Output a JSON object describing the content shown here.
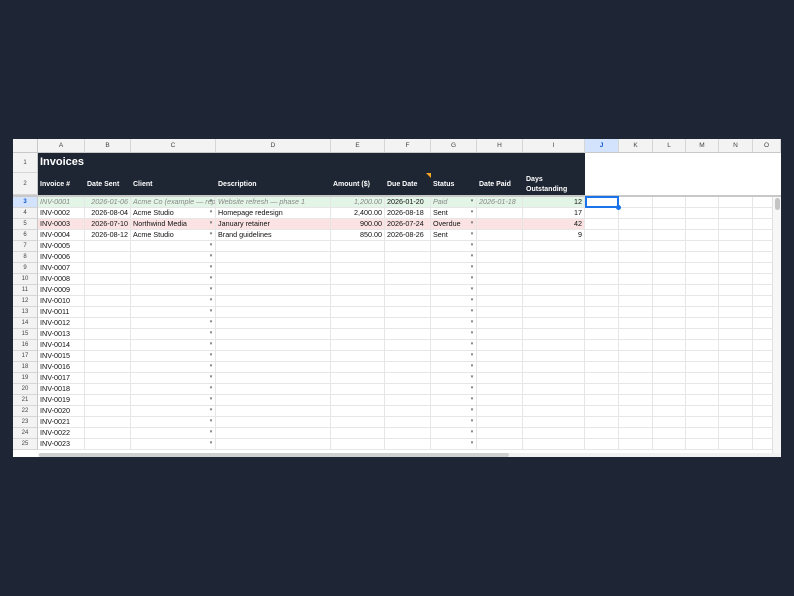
{
  "columns": [
    "A",
    "B",
    "C",
    "D",
    "E",
    "F",
    "G",
    "H",
    "I",
    "J",
    "K",
    "L",
    "M",
    "N",
    "O"
  ],
  "active_column": "J",
  "active_row": 3,
  "title": "Invoices",
  "headers": {
    "invoice": "Invoice #",
    "date_sent": "Date Sent",
    "client": "Client",
    "description": "Description",
    "amount": "Amount ($)",
    "due_date": "Due Date",
    "status": "Status",
    "date_paid": "Date Paid",
    "days_1": "Days",
    "days_2": "Outstanding"
  },
  "row_numbers": [
    "1",
    "2",
    "3",
    "4",
    "5",
    "6",
    "7",
    "8",
    "9",
    "10",
    "11",
    "12",
    "13",
    "14",
    "15",
    "16",
    "17",
    "18",
    "19",
    "20",
    "21",
    "22",
    "23",
    "24",
    "25"
  ],
  "rows": [
    {
      "invoice": "INV-0001",
      "date_sent": "2026-01-06",
      "client": "Acme Co (example — rep",
      "description": "Website refresh — phase 1",
      "amount": "1,200.00",
      "due_date": "2026-01-20",
      "status": "Paid",
      "date_paid": "2026-01-18",
      "days": "12"
    },
    {
      "invoice": "INV-0002",
      "date_sent": "2026-08-04",
      "client": "Acme Studio",
      "description": "Homepage redesign",
      "amount": "2,400.00",
      "due_date": "2026-08-18",
      "status": "Sent",
      "date_paid": "",
      "days": "17"
    },
    {
      "invoice": "INV-0003",
      "date_sent": "2026-07-10",
      "client": "Northwind Media",
      "description": "January retainer",
      "amount": "900.00",
      "due_date": "2026-07-24",
      "status": "Overdue",
      "date_paid": "",
      "days": "42"
    },
    {
      "invoice": "INV-0004",
      "date_sent": "2026-08-12",
      "client": "Acme Studio",
      "description": "Brand guidelines",
      "amount": "850.00",
      "due_date": "2026-08-26",
      "status": "Sent",
      "date_paid": "",
      "days": "9"
    },
    {
      "invoice": "INV-0005"
    },
    {
      "invoice": "INV-0006"
    },
    {
      "invoice": "INV-0007"
    },
    {
      "invoice": "INV-0008"
    },
    {
      "invoice": "INV-0009"
    },
    {
      "invoice": "INV-0010"
    },
    {
      "invoice": "INV-0011"
    },
    {
      "invoice": "INV-0012"
    },
    {
      "invoice": "INV-0013"
    },
    {
      "invoice": "INV-0014"
    },
    {
      "invoice": "INV-0015"
    },
    {
      "invoice": "INV-0016"
    },
    {
      "invoice": "INV-0017"
    },
    {
      "invoice": "INV-0018"
    },
    {
      "invoice": "INV-0019"
    },
    {
      "invoice": "INV-0020"
    },
    {
      "invoice": "INV-0021"
    },
    {
      "invoice": "INV-0022"
    },
    {
      "invoice": "INV-0023"
    }
  ],
  "colors": {
    "header_bg": "#1f2633",
    "paid_row": "#e3f5e6",
    "overdue_row": "#fbe3e4",
    "selection": "#1a73e8"
  },
  "icons": {
    "dropdown": "dropdown-arrow-icon"
  }
}
